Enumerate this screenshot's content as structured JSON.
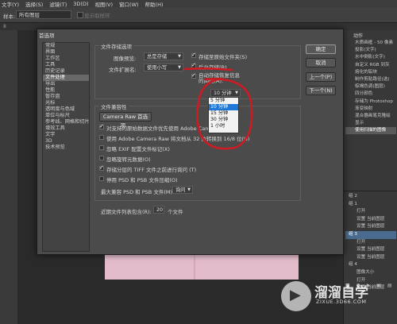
{
  "menu": [
    "文字(Y)",
    "选择(S)",
    "滤镜(T)",
    "3D(D)",
    "视图(V)",
    "窗口(W)",
    "帮助(H)"
  ],
  "options_bar": {
    "label": "样本:",
    "select": "所有图层",
    "disabled_label": "显示取样环"
  },
  "doc_tab": "8",
  "dialog": {
    "title": "首选项",
    "nav": [
      "常规",
      "界面",
      "工作区",
      "工具",
      "历史记录",
      "文件处理",
      "导出",
      "性能",
      "暂存盘",
      "光标",
      "透明度与色域",
      "单位与标尺",
      "参考线、网格和切片",
      "增效工具",
      "文字",
      "3D",
      "技术预览"
    ],
    "active_nav": 5,
    "save_group": {
      "title": "文件存储选项",
      "preview_label": "图像预览:",
      "preview_value": "总是存储",
      "ext_label": "文件扩展名:",
      "ext_value": "使用小写",
      "opt1": "存储至原始文件夹(S)",
      "opt2": "后台存储(B)",
      "opt3": "自动存储恢复信息的间隔(A):",
      "interval_value": "10 分钟"
    },
    "interval_options": [
      "5 分钟",
      "10 分钟",
      "15 分钟",
      "30 分钟",
      "1 小时"
    ],
    "interval_selected": 1,
    "compat_group": {
      "title": "文件兼容性",
      "camera_button": "Camera Raw 首选项...",
      "items": [
        {
          "text": "对支持的原始数据文件优先使用 Adobe Camera",
          "checked": true
        },
        {
          "text": "使用 Adobe Camera Raw 将文档从 32 位转换到 16/8 位(U)",
          "checked": false
        },
        {
          "text": "忽略 EXIF 配置文件标记(X)",
          "checked": false
        },
        {
          "text": "忽略旋转元数据(O)",
          "checked": false
        },
        {
          "text": "存储分层的 TIFF 文件之前进行询问 (T)",
          "checked": true
        },
        {
          "text": "停用 PSD 和 PSB 文件压缩(O)",
          "checked": false
        }
      ],
      "max_label": "最大兼容 PSD 和 PSB 文件(M):",
      "max_value": "询问"
    },
    "recent_label": "近期文件列表包含(R):",
    "recent_value": "20",
    "recent_unit": "个文件",
    "buttons": {
      "ok": "确定",
      "cancel": "取消",
      "prev": "上一个(P)",
      "next": "下一个(N)"
    }
  },
  "panel": {
    "tab": "动作",
    "history": [
      "木质画框 - 50 像素",
      "投影(文字)",
      "水中倒影(文字)",
      "自定义 RGB 到灰",
      "熔化的铅块",
      "制作剪贴路径(选)",
      "棕褐色调(图层)",
      "四分颜色",
      "存储为 Photoshop",
      "渐变映射",
      "混合器画笔克隆绘",
      "显示",
      "使用扫描的图像"
    ],
    "history_selected": 12,
    "layers": [
      "组 2",
      "组 1",
      "打开",
      "设置 当前图层",
      "设置 当前图层",
      "组 3",
      "打开",
      "设置 当前图层",
      "设置 当前图层",
      "组 4",
      "图像大小",
      "打开",
      "设置 当前图层"
    ],
    "layers_selected": 5,
    "footer": "■ ● ▶ ▣ ▤ ⌫"
  },
  "watermark": {
    "name": "溜溜自学",
    "url": "ZIXUE.3D66.COM"
  },
  "colors": {
    "annotation": "#d01a22",
    "highlight": "#1e78d7"
  }
}
